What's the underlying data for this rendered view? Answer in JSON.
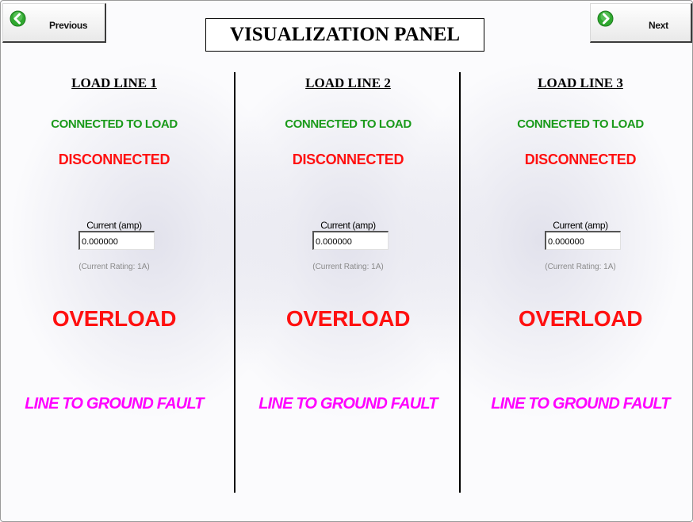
{
  "nav": {
    "previous_label": "Previous",
    "next_label": "Next",
    "icon_color": "#2fa82f"
  },
  "title": "VISUALIZATION PANEL",
  "lines": [
    {
      "heading": "LOAD LINE 1",
      "connected": "CONNECTED TO LOAD",
      "disconnected": "DISCONNECTED",
      "current_label": "Current (amp)",
      "current_value": "0.000000",
      "rating": "(Current Rating: 1A)",
      "overload": "OVERLOAD",
      "fault": "LINE TO GROUND FAULT"
    },
    {
      "heading": "LOAD LINE 2",
      "connected": "CONNECTED TO LOAD",
      "disconnected": "DISCONNECTED",
      "current_label": "Current (amp)",
      "current_value": "0.000000",
      "rating": "(Current Rating: 1A)",
      "overload": "OVERLOAD",
      "fault": "LINE TO GROUND FAULT"
    },
    {
      "heading": "LOAD LINE 3",
      "connected": "CONNECTED TO LOAD",
      "disconnected": "DISCONNECTED",
      "current_label": "Current (amp)",
      "current_value": "0.000000",
      "rating": "(Current Rating: 1A)",
      "overload": "OVERLOAD",
      "fault": "LINE TO GROUND FAULT"
    }
  ],
  "colors": {
    "connected": "#1a9a1a",
    "disconnected": "#ff1010",
    "overload": "#ff1010",
    "fault": "#ff00ff",
    "rating": "#8a8a8a"
  }
}
